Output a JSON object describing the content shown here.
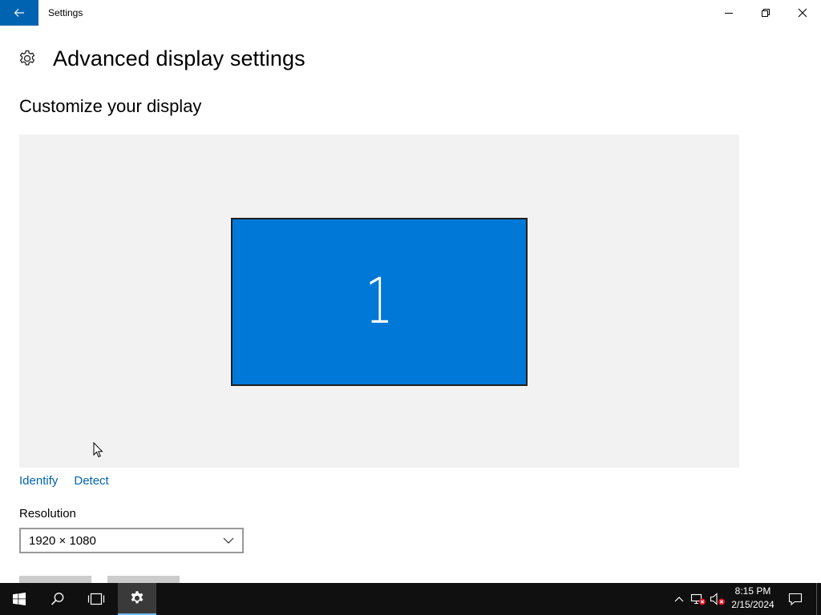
{
  "window": {
    "title": "Settings"
  },
  "page": {
    "title": "Advanced display settings",
    "section_title": "Customize your display"
  },
  "display_preview": {
    "monitors": [
      {
        "label": "1",
        "color": "#0078d7"
      }
    ]
  },
  "links": {
    "identify": "Identify",
    "detect": "Detect"
  },
  "resolution": {
    "label": "Resolution",
    "value": "1920 × 1080"
  },
  "taskbar": {
    "pinned": [
      "start-icon",
      "search-icon",
      "task-view-icon",
      "settings-icon"
    ],
    "active": "settings",
    "clock": {
      "time": "8:15 PM",
      "date": "2/15/2024"
    }
  },
  "colors": {
    "accent": "#0078d7",
    "back_button": "#0063b1",
    "link": "#0063b1",
    "taskbar": "#101010"
  }
}
